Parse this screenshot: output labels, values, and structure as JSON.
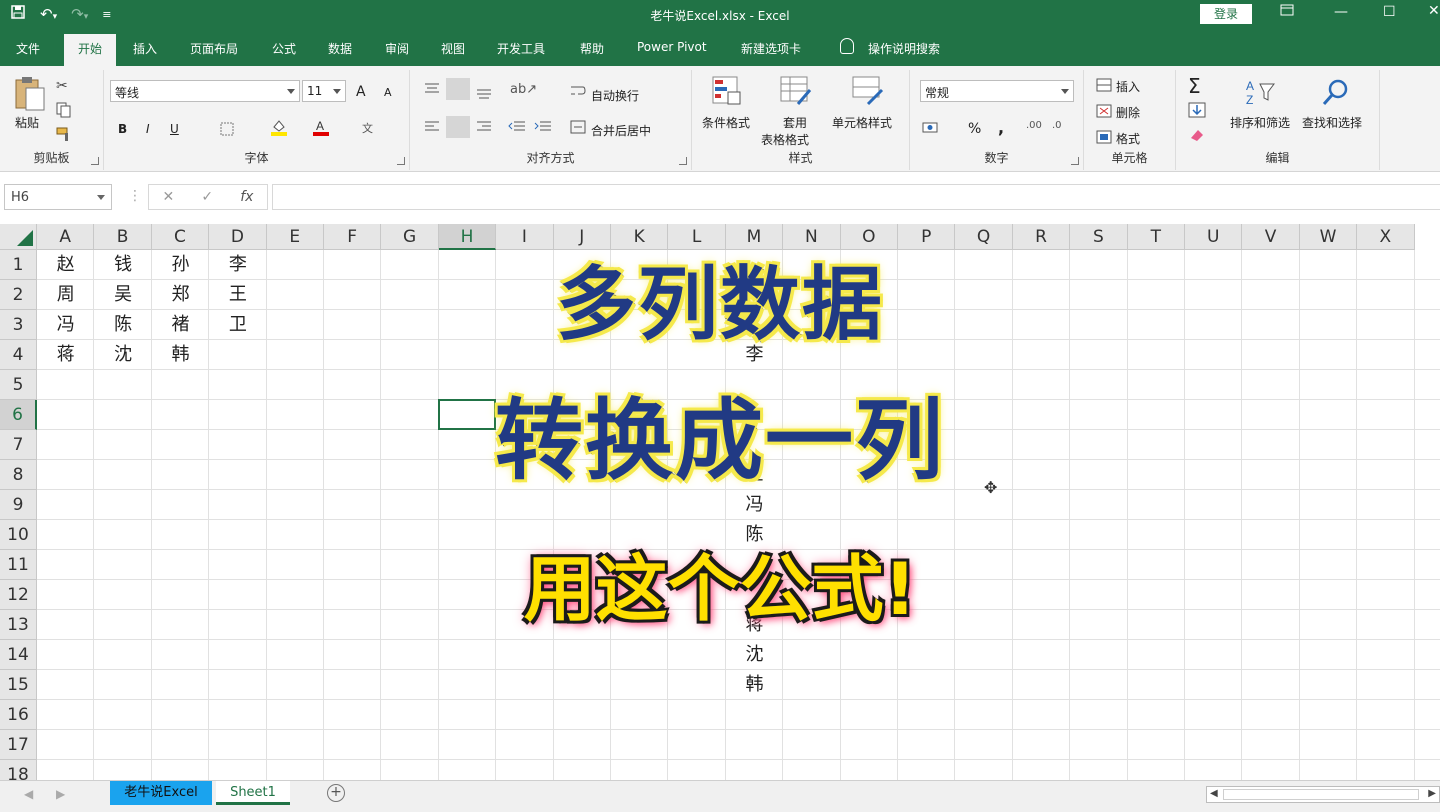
{
  "titlebar": {
    "title": "老牛说Excel.xlsx  -  Excel",
    "login_label": "登录",
    "icons": [
      "save-icon",
      "undo-icon",
      "redo-icon",
      "customize-qat-icon"
    ]
  },
  "tabs": [
    {
      "label": "文件"
    },
    {
      "label": "开始"
    },
    {
      "label": "插入"
    },
    {
      "label": "页面布局"
    },
    {
      "label": "公式"
    },
    {
      "label": "数据"
    },
    {
      "label": "审阅"
    },
    {
      "label": "视图"
    },
    {
      "label": "开发工具"
    },
    {
      "label": "帮助"
    },
    {
      "label": "Power Pivot"
    },
    {
      "label": "新建选项卡"
    }
  ],
  "tell_me": "操作说明搜索",
  "ribbon": {
    "clipboard": {
      "paste": "粘贴",
      "label": "剪贴板"
    },
    "font": {
      "name": "等线",
      "size": "11",
      "label": "字体",
      "bold": "B",
      "italic": "I",
      "underline": "U",
      "grow": "A",
      "shrink": "A"
    },
    "alignment": {
      "wrap": "自动换行",
      "merge": "合并后居中",
      "label": "对齐方式"
    },
    "styles": {
      "conditional": "条件格式",
      "table_1": "套用",
      "table_2": "表格格式",
      "cell_styles": "单元格样式",
      "label": "样式"
    },
    "number": {
      "format": "常规",
      "label": "数字",
      "percent": "%",
      "comma": ","
    },
    "cells": {
      "insert": "插入",
      "delete": "删除",
      "format": "格式",
      "label": "单元格"
    },
    "editing": {
      "sort": "排序和筛选",
      "find": "查找和选择",
      "label": "编辑",
      "sigma": "Σ"
    }
  },
  "formula_bar": {
    "name_box": "H6",
    "cancel": "✕",
    "enter": "✓",
    "fx": "fx"
  },
  "columns": [
    "A",
    "B",
    "C",
    "D",
    "E",
    "F",
    "G",
    "H",
    "I",
    "J",
    "K",
    "L",
    "M",
    "N",
    "O",
    "P",
    "Q",
    "R",
    "S",
    "T",
    "U",
    "V",
    "W",
    "X"
  ],
  "selected_column": "H",
  "rows": [
    "1",
    "2",
    "3",
    "4",
    "5",
    "6",
    "7",
    "8",
    "9",
    "10",
    "11",
    "12",
    "13",
    "14",
    "15",
    "16",
    "17",
    "18"
  ],
  "selected_row": "6",
  "cells": {
    "A1": "赵",
    "B1": "钱",
    "C1": "孙",
    "D1": "李",
    "A2": "周",
    "B2": "吴",
    "C2": "郑",
    "D2": "王",
    "A3": "冯",
    "B3": "陈",
    "C3": "褚",
    "D3": "卫",
    "A4": "蒋",
    "B4": "沈",
    "C4": "韩",
    "M4": "李",
    "M8": "王",
    "M9": "冯",
    "M10": "陈",
    "M13": "蒋",
    "M14": "沈",
    "M15": "韩"
  },
  "overlay": {
    "line1": "多列数据",
    "line2": "转换成一列",
    "line3": "用这个公式!"
  },
  "sheets": [
    {
      "name": "老牛说Excel"
    },
    {
      "name": "Sheet1"
    }
  ],
  "add_sheet": "+"
}
